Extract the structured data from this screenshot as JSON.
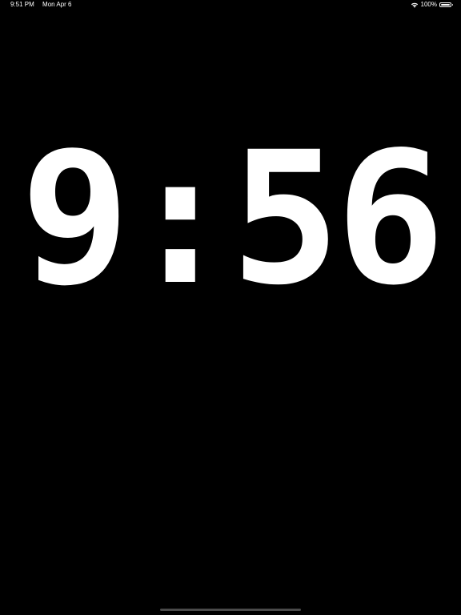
{
  "status_bar": {
    "time": "9:51 PM",
    "date": "Mon Apr 6",
    "battery_percent": "100%",
    "battery_level": 1.0,
    "wifi_icon": "wifi-icon",
    "battery_icon": "battery-icon"
  },
  "clock": {
    "hours": "9",
    "separator": ":",
    "minutes": "56",
    "color": "#ffffff",
    "background": "#000000"
  },
  "home_indicator": {
    "color": "#4a4a4a"
  }
}
